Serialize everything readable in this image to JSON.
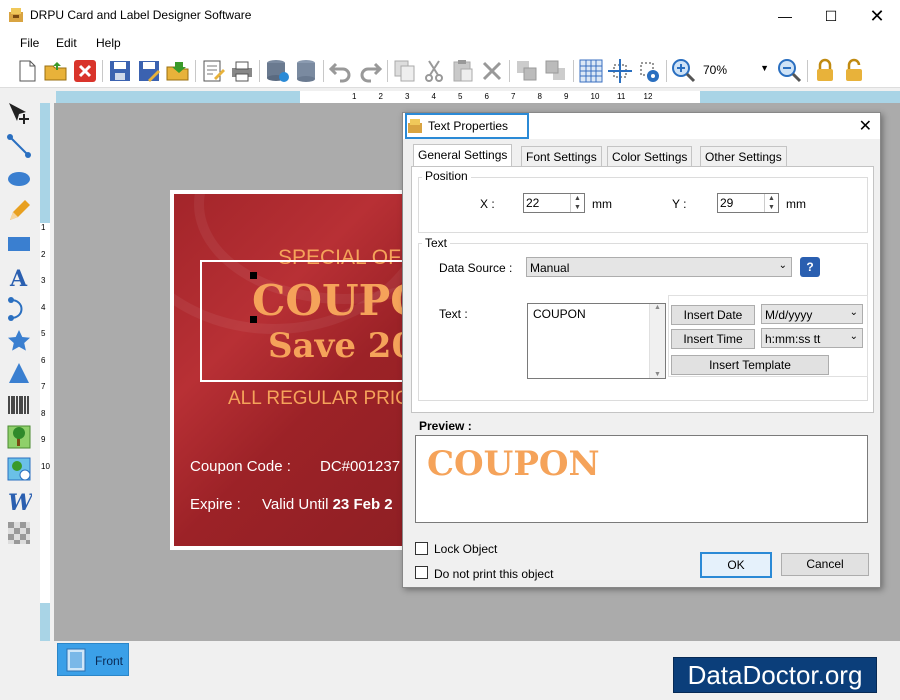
{
  "window": {
    "title": "DRPU Card and Label Designer Software"
  },
  "menu": [
    "File",
    "Edit",
    "Help"
  ],
  "toolbar": {
    "zoom": "70%"
  },
  "ruler": {
    "top_numbers": [
      "1",
      "2",
      "3",
      "4",
      "5",
      "6",
      "7",
      "8",
      "9",
      "10",
      "11",
      "12"
    ],
    "left_numbers": [
      "1",
      "2",
      "3",
      "4",
      "5",
      "6",
      "7",
      "8",
      "9",
      "10"
    ]
  },
  "card": {
    "line1": "SPECIAL OF",
    "line2": "COUPO",
    "line3": "Save 20",
    "line4": "ALL REGULAR PRIC",
    "code_label": "Coupon Code :",
    "code_value": "DC#001237",
    "expire_label": "Expire :",
    "expire_value_prefix": "Valid Until ",
    "expire_value_bold": "23 Feb 2"
  },
  "bottom": {
    "tab_front": "Front",
    "brand": "DataDoctor.org"
  },
  "dialog": {
    "title": "Text Properties",
    "tabs": [
      "General Settings",
      "Font Settings",
      "Color Settings",
      "Other Settings"
    ],
    "position": {
      "group": "Position",
      "x_label": "X :",
      "x_value": "22",
      "x_unit": "mm",
      "y_label": "Y :",
      "y_value": "29",
      "y_unit": "mm"
    },
    "text_group": "Text",
    "data_source_label": "Data Source :",
    "data_source_value": "Manual",
    "text_label": "Text :",
    "text_value": "COUPON",
    "insert_date": "Insert Date",
    "date_format": "M/d/yyyy",
    "insert_time": "Insert Time",
    "time_format": "h:mm:ss tt",
    "insert_template": "Insert Template",
    "preview_label": "Preview :",
    "preview_text": "COUPON",
    "lock_object": "Lock Object",
    "do_not_print": "Do not print this object",
    "ok": "OK",
    "cancel": "Cancel"
  },
  "colors": {
    "card_red": "#a3252a",
    "card_accent": "#f5a35a",
    "highlight": "#2b8ad6",
    "brand_bg": "#0b3e7a"
  }
}
